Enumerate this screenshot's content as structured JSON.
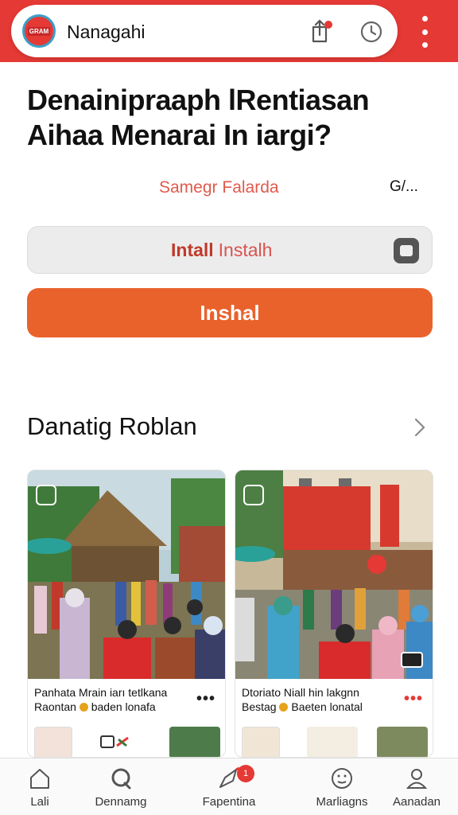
{
  "header": {
    "logo_text": "GRAM",
    "app_name": "Nanagahi",
    "notification_icon": "share-notification-icon",
    "history_icon": "clock-icon",
    "menu_icon": "more-vertical-icon",
    "brand_color": "#e53935"
  },
  "hero": {
    "headline_line1": "Denainipraaph lRentiasan",
    "headline_line2": "Aihaa Menarai In iargi?",
    "subtitle": "Samegr Falarda",
    "right_tag": "G/..."
  },
  "buttons": {
    "install_secondary_bold": "Intall",
    "install_secondary_light": "Instalh",
    "install_primary": "Inshal",
    "primary_color": "#e9622c"
  },
  "section": {
    "title": "Danatig Roblan"
  },
  "cards": [
    {
      "caption_line1": "Panhata Mrain iarı tetlkana",
      "caption_line2_a": "Raontan",
      "caption_line2_b": "baden lonafa",
      "more": "•••"
    },
    {
      "caption_line1": "Dtoriato Niall hin lakgnn",
      "caption_line2_a": "Bestag",
      "caption_line2_b": "Baeten lonatal",
      "more": "•••"
    }
  ],
  "nav": [
    {
      "label": "Lali",
      "icon": "home-icon"
    },
    {
      "label": "Dennamg",
      "icon": "search-icon"
    },
    {
      "label": "Fapentina",
      "icon": "rocket-icon",
      "badge": "1"
    },
    {
      "label": "Marliagns",
      "icon": "face-icon"
    },
    {
      "label": "Aanadan",
      "icon": "profile-icon"
    }
  ]
}
